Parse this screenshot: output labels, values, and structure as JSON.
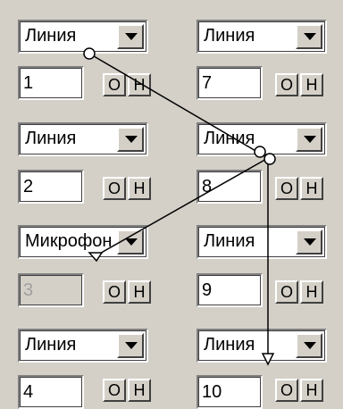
{
  "channels": [
    {
      "source": "Линия",
      "number": "1",
      "o_label": "О",
      "h_label": "Н",
      "disabled": false
    },
    {
      "source": "Линия",
      "number": "2",
      "o_label": "О",
      "h_label": "Н",
      "disabled": false
    },
    {
      "source": "Микрофон",
      "number": "3",
      "o_label": "О",
      "h_label": "Н",
      "disabled": true
    },
    {
      "source": "Линия",
      "number": "4",
      "o_label": "О",
      "h_label": "Н",
      "disabled": false
    },
    {
      "source": "Линия",
      "number": "7",
      "o_label": "О",
      "h_label": "Н",
      "disabled": false
    },
    {
      "source": "Линия",
      "number": "8",
      "o_label": "О",
      "h_label": "Н",
      "disabled": false
    },
    {
      "source": "Линия",
      "number": "9",
      "o_label": "О",
      "h_label": "Н",
      "disabled": false
    },
    {
      "source": "Линия",
      "number": "10",
      "o_label": "О",
      "h_label": "Н",
      "disabled": false
    }
  ],
  "icons": {
    "dropdown": "triangle-down-icon",
    "connector_start": "circle-icon",
    "connector_end": "arrowhead-icon"
  },
  "colors": {
    "background": "#d4d0c8",
    "field": "#ffffff",
    "disabled_text": "#a0a0a0"
  }
}
